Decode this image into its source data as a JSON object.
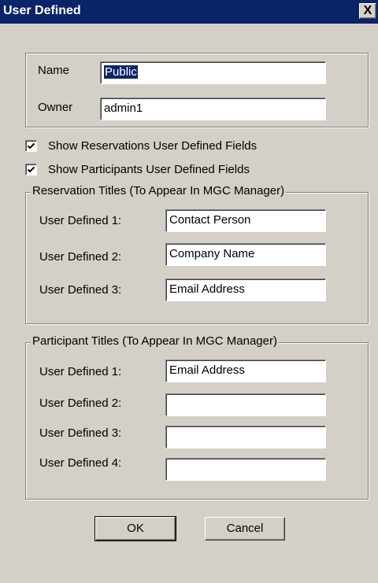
{
  "window": {
    "title": "User Defined",
    "close_symbol": "X"
  },
  "name_group": {
    "name_label": "Name",
    "name_value": "Public",
    "owner_label": "Owner",
    "owner_value": "admin1"
  },
  "checkboxes": {
    "show_reservations": {
      "label": "Show Reservations User Defined Fields",
      "checked": true
    },
    "show_participants": {
      "label": "Show Participants User Defined Fields",
      "checked": true
    }
  },
  "reservation_titles": {
    "legend": "Reservation Titles (To Appear In MGC Manager)",
    "fields": [
      {
        "label": "User Defined 1:",
        "value": "Contact Person"
      },
      {
        "label": "User Defined 2:",
        "value": "Company Name"
      },
      {
        "label": "User Defined 3:",
        "value": "Email Address"
      }
    ]
  },
  "participant_titles": {
    "legend": "Participant Titles (To Appear In MGC Manager)",
    "fields": [
      {
        "label": "User Defined 1:",
        "value": "Email Address"
      },
      {
        "label": "User Defined 2:",
        "value": ""
      },
      {
        "label": "User Defined 3:",
        "value": ""
      },
      {
        "label": "User Defined 4:",
        "value": ""
      }
    ]
  },
  "buttons": {
    "ok": "OK",
    "cancel": "Cancel"
  }
}
